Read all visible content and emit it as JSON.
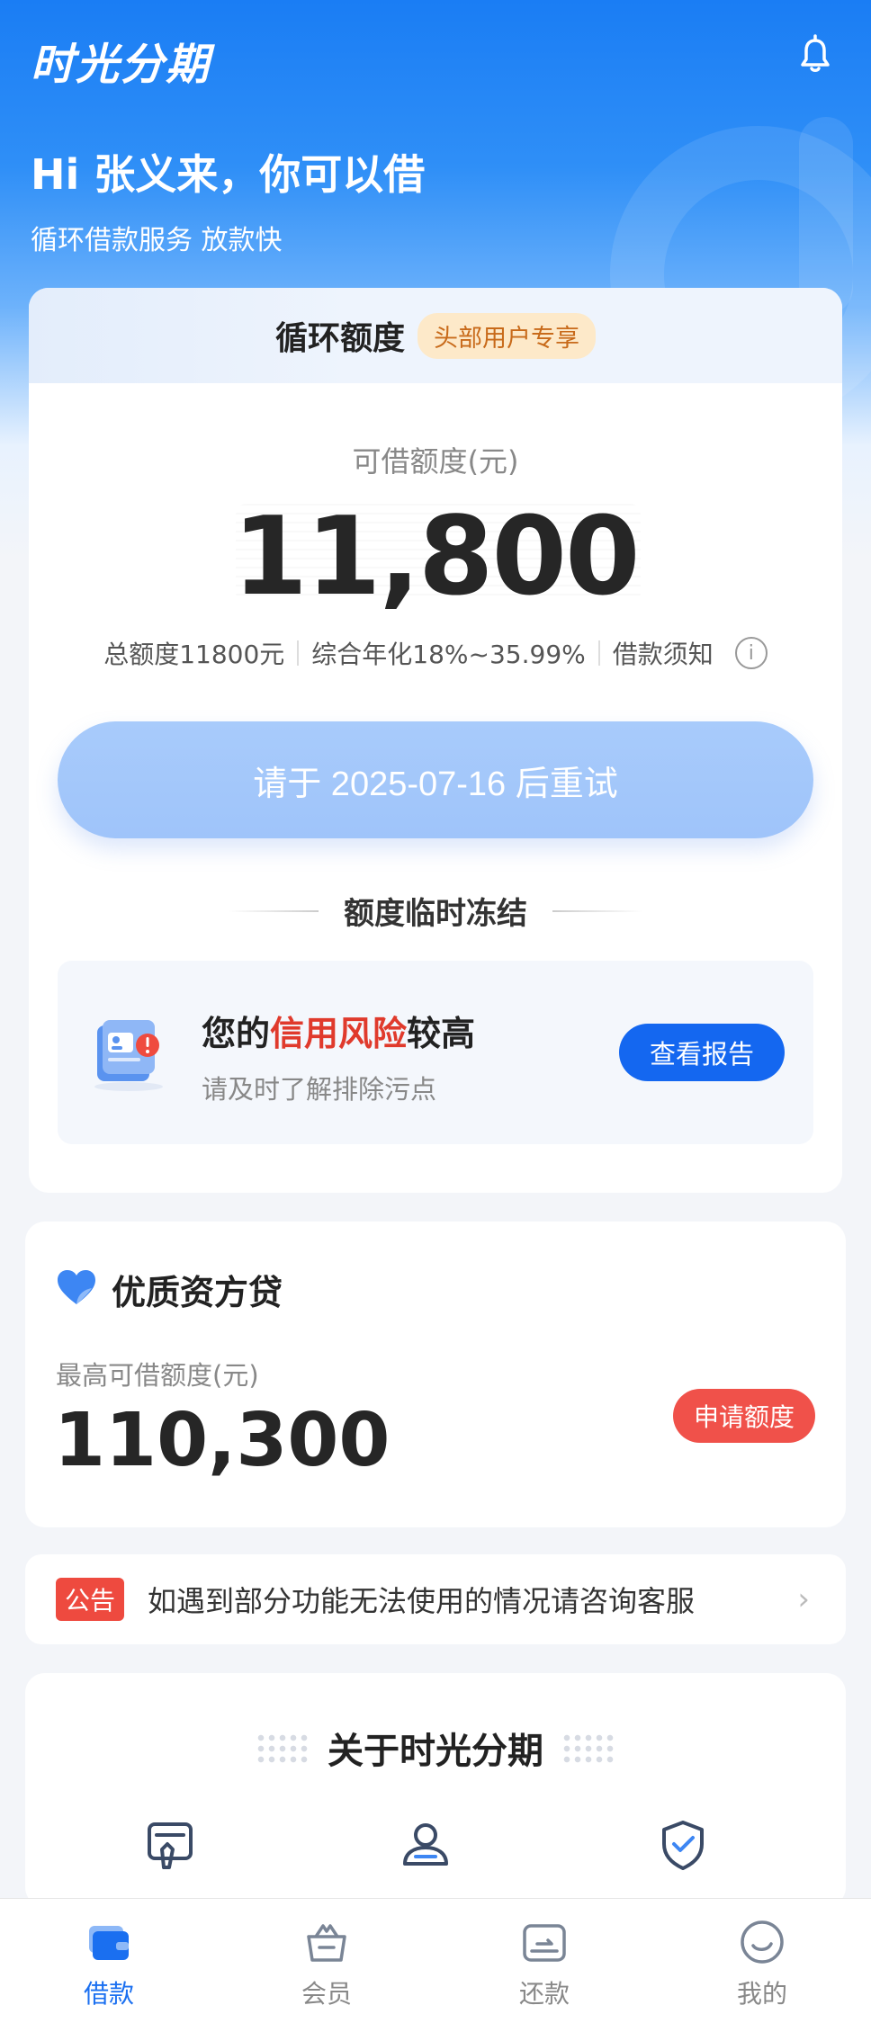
{
  "header": {
    "app_name": "时光分期",
    "bell_icon": "bell-icon",
    "greeting": "Hi 张义来，你可以借",
    "sub_greeting": "循环借款服务 放款快"
  },
  "revolving_card": {
    "title": "循环额度",
    "badge": "头部用户专享",
    "limit_label": "可借额度(元)",
    "limit_value": "11,800",
    "total_limit": "总额度11800元",
    "annual_rate": "综合年化18%~35.99%",
    "loan_notice": "借款须知",
    "retry_button": "请于 2025-07-16 后重试",
    "freeze_title": "额度临时冻结",
    "risk": {
      "title_prefix": "您的",
      "title_highlight": "信用风险",
      "title_suffix": "较高",
      "subtitle": "请及时了解排除污点",
      "report_button": "查看报告"
    }
  },
  "premium_loan": {
    "title": "优质资方贷",
    "label": "最高可借额度(元)",
    "value": "110,300",
    "apply_button": "申请额度"
  },
  "notice": {
    "tag": "公告",
    "text": "如遇到部分功能无法使用的情况请咨询客服"
  },
  "about": {
    "title": "关于时光分期",
    "icons": [
      "contract-icon",
      "user-icon",
      "shield-icon"
    ]
  },
  "tabbar": {
    "items": [
      {
        "label": "借款",
        "icon": "wallet-icon",
        "active": true
      },
      {
        "label": "会员",
        "icon": "crown-basket-icon",
        "active": false
      },
      {
        "label": "还款",
        "icon": "repay-card-icon",
        "active": false
      },
      {
        "label": "我的",
        "icon": "smile-icon",
        "active": false
      }
    ]
  },
  "colors": {
    "brand_blue": "#1a7df4",
    "button_blue": "#1467f0",
    "alert_red": "#e03a2c",
    "apply_red": "#f0514a"
  }
}
